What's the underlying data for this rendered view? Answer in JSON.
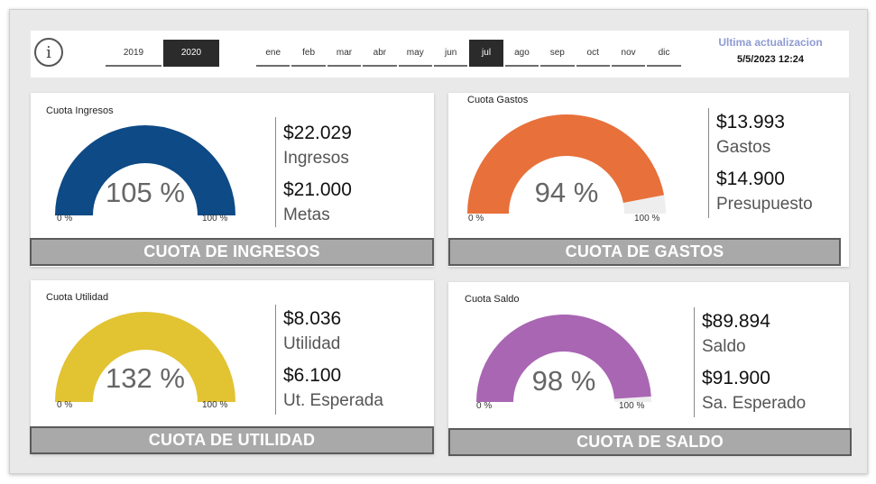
{
  "header": {
    "info_icon": "info-icon",
    "years": [
      "2019",
      "2020"
    ],
    "selected_year": "2020",
    "months": [
      "ene",
      "feb",
      "mar",
      "abr",
      "may",
      "jun",
      "jul",
      "ago",
      "sep",
      "oct",
      "nov",
      "dic"
    ],
    "selected_month": "jul",
    "update_label": "Ultima actualizacion",
    "update_value": "5/5/2023 12:24"
  },
  "colors": {
    "ingresos": "#0d4a86",
    "gastos": "#e8703a",
    "utilidad": "#e2c332",
    "saldo": "#a966b3",
    "gauge_track": "#eeeeee",
    "banner_bg": "#a9a9a9"
  },
  "cards": {
    "ingresos": {
      "title": "Cuota Ingresos",
      "percent_text": "105 %",
      "fill_fraction": 1.0,
      "min_label": "0 %",
      "max_label": "100 %",
      "value1": "$22.029",
      "label1": "Ingresos",
      "value2": "$21.000",
      "label2": "Metas",
      "banner": "CUOTA DE INGRESOS"
    },
    "gastos": {
      "title": "Cuota Gastos",
      "percent_text": "94 %",
      "fill_fraction": 0.94,
      "min_label": "0 %",
      "max_label": "100 %",
      "value1": "$13.993",
      "label1": "Gastos",
      "value2": "$14.900",
      "label2": "Presupuesto",
      "banner": "CUOTA DE GASTOS"
    },
    "utilidad": {
      "title": "Cuota Utilidad",
      "percent_text": "132 %",
      "fill_fraction": 1.0,
      "min_label": "0 %",
      "max_label": "100 %",
      "value1": "$8.036",
      "label1": "Utilidad",
      "value2": "$6.100",
      "label2": "Ut. Esperada",
      "banner": "CUOTA DE UTILIDAD"
    },
    "saldo": {
      "title": "Cuota Saldo",
      "percent_text": "98 %",
      "fill_fraction": 0.98,
      "min_label": "0 %",
      "max_label": "100 %",
      "value1": "$89.894",
      "label1": "Saldo",
      "value2": "$91.900",
      "label2": "Sa. Esperado",
      "banner": "CUOTA DE SALDO"
    }
  }
}
